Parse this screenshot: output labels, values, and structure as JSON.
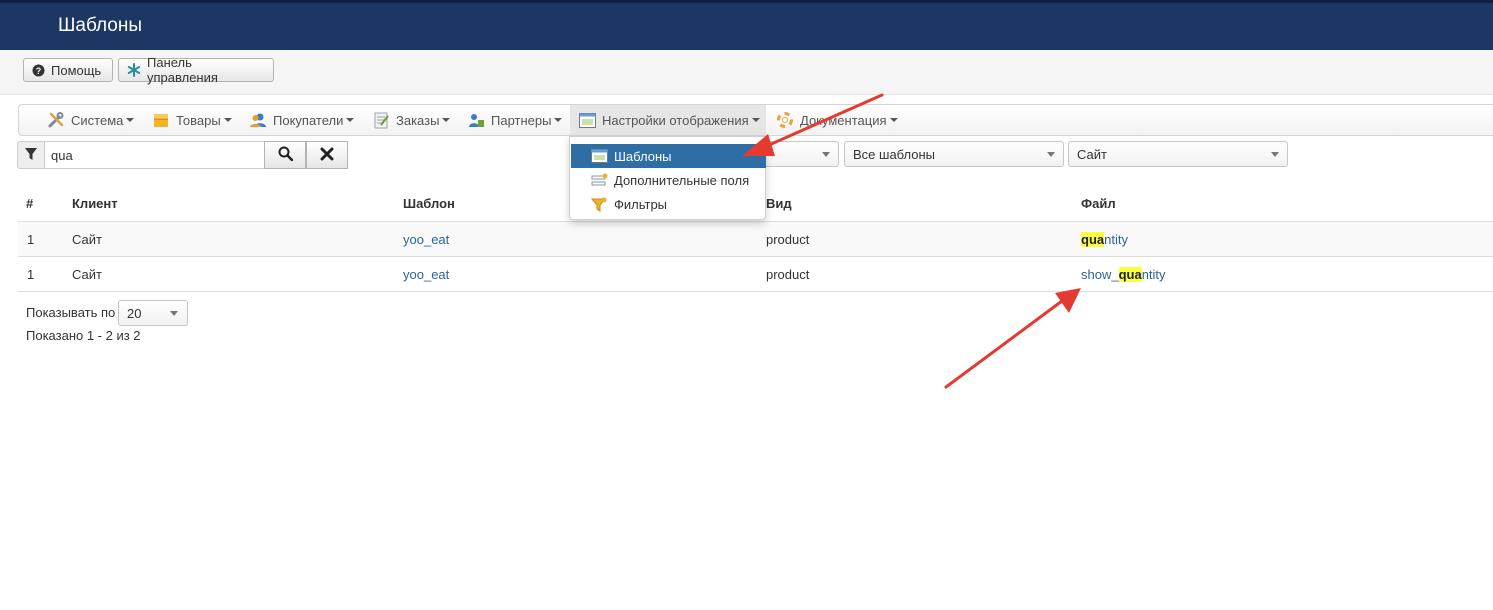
{
  "header": {
    "title": "Шаблоны"
  },
  "toolbar": {
    "help_label": "Помощь",
    "dashboard_label": "Панель управления"
  },
  "nav": {
    "items": [
      {
        "label": "Система",
        "icon": "tools-icon"
      },
      {
        "label": "Товары",
        "icon": "box-icon"
      },
      {
        "label": "Покупатели",
        "icon": "users-icon"
      },
      {
        "label": "Заказы",
        "icon": "orders-icon"
      },
      {
        "label": "Партнеры",
        "icon": "partners-icon"
      },
      {
        "label": "Настройки отображения",
        "icon": "display-settings-icon"
      },
      {
        "label": "Документация",
        "icon": "lifebuoy-icon"
      }
    ],
    "active_index": 5
  },
  "dropdown": {
    "items": [
      {
        "label": "Шаблоны",
        "icon": "window-icon",
        "active": true
      },
      {
        "label": "Дополнительные поля",
        "icon": "fields-icon",
        "active": false
      },
      {
        "label": "Фильтры",
        "icon": "funnel-icon",
        "active": false
      }
    ]
  },
  "search": {
    "value": "qua"
  },
  "filters": {
    "first_value": "",
    "templates_value": "Все шаблоны",
    "site_value": "Сайт"
  },
  "table": {
    "columns": [
      "#",
      "Клиент",
      "Шаблон",
      "Вид",
      "Файл"
    ],
    "rows": [
      {
        "num": "1",
        "client": "Сайт",
        "template": "yoo_eat",
        "view": "product",
        "file_prefix": "",
        "file_match": "qua",
        "file_suffix": "ntity"
      },
      {
        "num": "1",
        "client": "Сайт",
        "template": "yoo_eat",
        "view": "product",
        "file_prefix": "show_",
        "file_match": "qua",
        "file_suffix": "ntity"
      }
    ]
  },
  "pagination": {
    "label": "Показывать по",
    "per_page": "20",
    "summary": "Показано 1 - 2 из 2"
  },
  "colors": {
    "header_bg": "#1c3764",
    "active_item": "#2f6ea5",
    "link": "#2a6496",
    "highlight": "#fbff3d",
    "annotation_arrow": "#e53a2f"
  }
}
